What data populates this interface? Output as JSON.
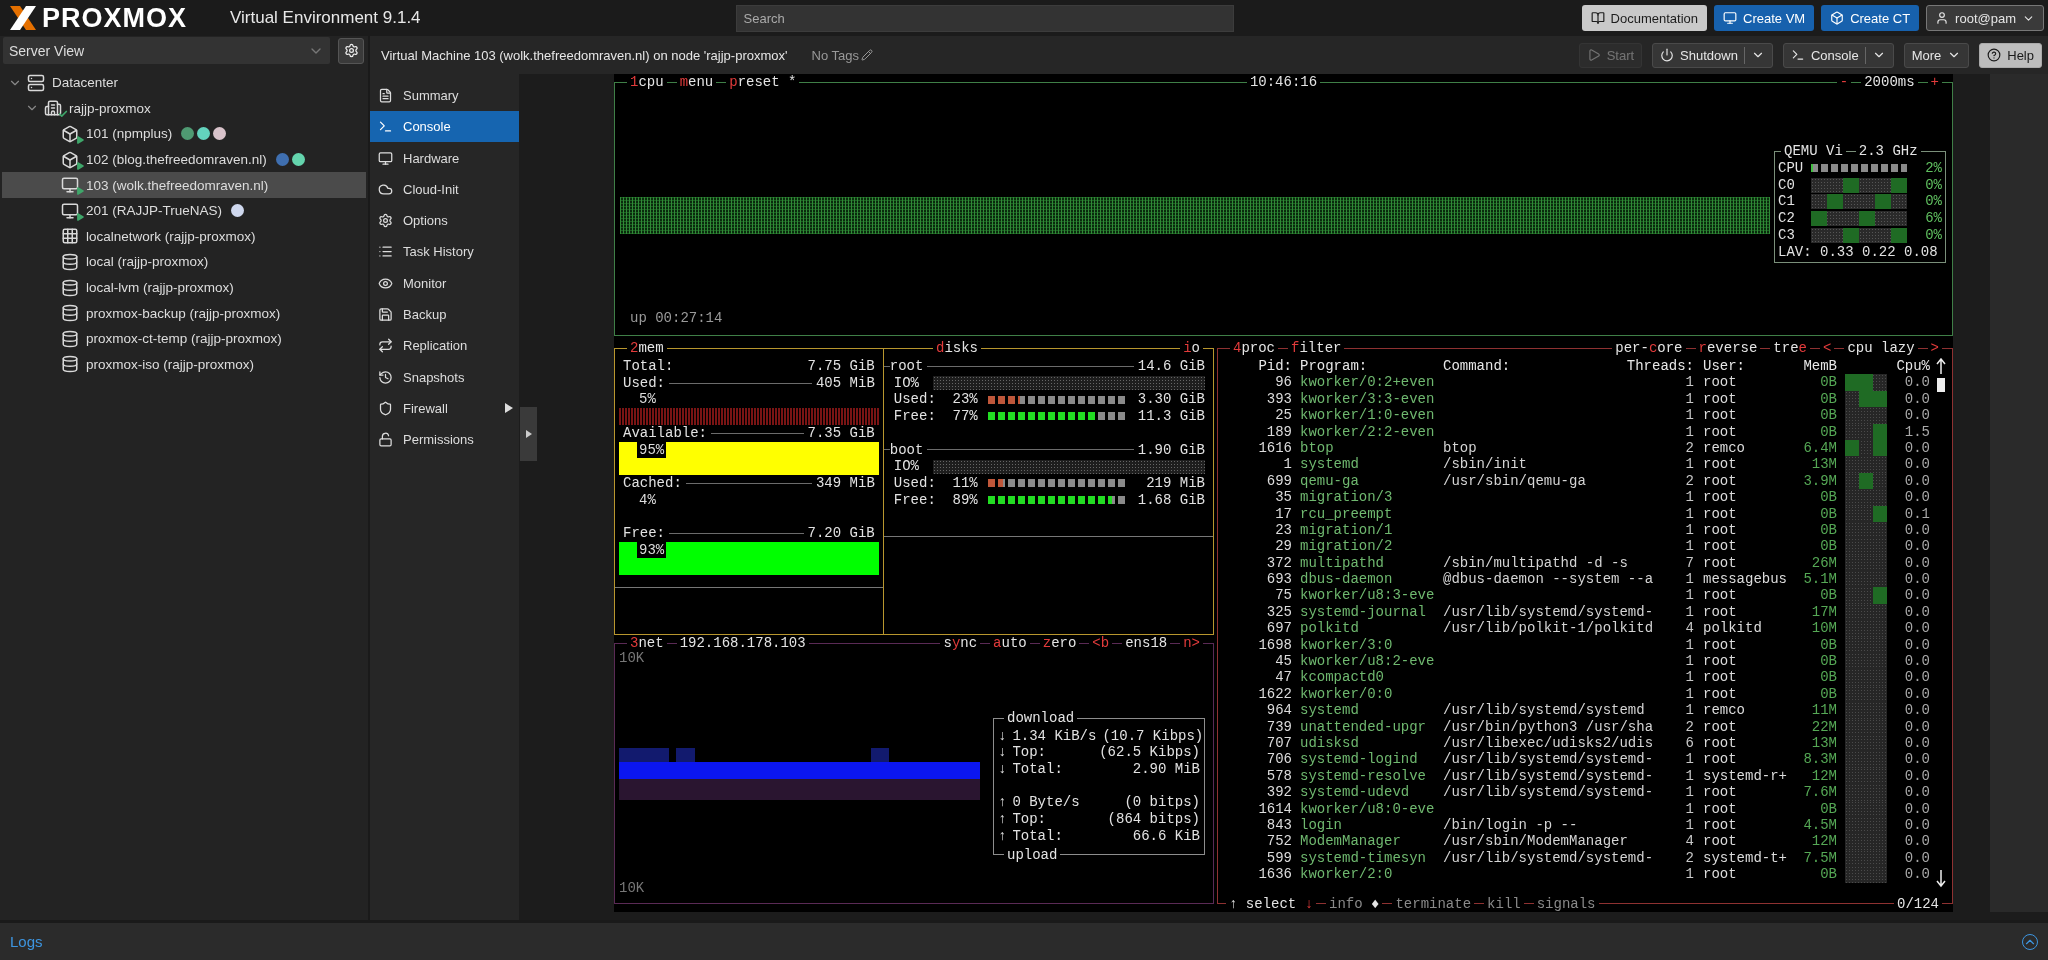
{
  "topbar": {
    "brand": "PROXMOX",
    "product": "Virtual Environment 9.1.4",
    "search": {
      "placeholder": "Search"
    },
    "buttons": [
      {
        "label": "Documentation",
        "kind": "light"
      },
      {
        "label": "Create VM",
        "kind": "primary"
      },
      {
        "label": "Create CT",
        "kind": "primary"
      },
      {
        "label": "root@pam",
        "kind": "menu"
      }
    ]
  },
  "sidebar": {
    "view": "Server View",
    "tree": [
      {
        "label": "Datacenter",
        "kind": "datacenter",
        "expanded": true,
        "selected": false,
        "children": [
          {
            "label": "rajjp-proxmox",
            "kind": "node",
            "online": true,
            "expanded": true,
            "selected": false,
            "children": [
              {
                "label": "101 (npmplus)",
                "kind": "ct",
                "running": true,
                "selected": false,
                "tags": [
                  {
                    "color": "#4f9a72"
                  },
                  {
                    "color": "#63d3bd"
                  },
                  {
                    "color": "#d9c3cb"
                  }
                ]
              },
              {
                "label": "102 (blog.thefreedomraven.nl)",
                "kind": "ct",
                "running": true,
                "selected": false,
                "tags": [
                  {
                    "color": "#3f6fb0"
                  },
                  {
                    "color": "#64d4ad"
                  }
                ]
              },
              {
                "label": "103 (wolk.thefreedomraven.nl)",
                "kind": "vm",
                "running": true,
                "selected": true
              },
              {
                "label": "201 (RAJJP-TrueNAS)",
                "kind": "vm",
                "running": true,
                "selected": false,
                "tags": [
                  {
                    "color": "#cfd8ee"
                  }
                ]
              },
              {
                "label": "localnetwork (rajjp-proxmox)",
                "kind": "sdn",
                "selected": false
              },
              {
                "label": "local (rajjp-proxmox)",
                "kind": "storage",
                "selected": false
              },
              {
                "label": "local-lvm (rajjp-proxmox)",
                "kind": "storage",
                "selected": false
              },
              {
                "label": "proxmox-backup (rajjp-proxmox)",
                "kind": "storage",
                "selected": false
              },
              {
                "label": "proxmox-ct-temp (rajjp-proxmox)",
                "kind": "storage",
                "selected": false
              },
              {
                "label": "proxmox-iso (rajjp-proxmox)",
                "kind": "storage",
                "selected": false
              }
            ]
          }
        ]
      }
    ]
  },
  "content": {
    "title": "Virtual Machine 103 (wolk.thefreedomraven.nl) on node 'rajjp-proxmox'",
    "tags": "No Tags",
    "toolbar": [
      {
        "label": "Start",
        "kind": "plain",
        "disabled": true
      },
      {
        "label": "Shutdown",
        "kind": "split",
        "disabled": false
      },
      {
        "label": "Console",
        "kind": "split",
        "disabled": false
      },
      {
        "label": "More",
        "kind": "menu",
        "disabled": false
      },
      {
        "label": "Help",
        "kind": "light",
        "disabled": false
      }
    ]
  },
  "nav": [
    {
      "label": "Summary",
      "selected": false,
      "submenu": false
    },
    {
      "label": "Console",
      "selected": true,
      "submenu": false
    },
    {
      "label": "Hardware",
      "selected": false,
      "submenu": false
    },
    {
      "label": "Cloud-Init",
      "selected": false,
      "submenu": false
    },
    {
      "label": "Options",
      "selected": false,
      "submenu": false
    },
    {
      "label": "Task History",
      "selected": false,
      "submenu": false
    },
    {
      "label": "Monitor",
      "selected": false,
      "submenu": false
    },
    {
      "label": "Backup",
      "selected": false,
      "submenu": false
    },
    {
      "label": "Replication",
      "selected": false,
      "submenu": false
    },
    {
      "label": "Snapshots",
      "selected": false,
      "submenu": false
    },
    {
      "label": "Firewall",
      "selected": false,
      "submenu": true
    },
    {
      "label": "Permissions",
      "selected": false,
      "submenu": false
    }
  ],
  "terminal": {
    "cpu": {
      "titles": [
        [
          {
            "text": "1",
            "hotkey": true
          },
          {
            "text": "cpu",
            "hotkey": false
          }
        ],
        [
          {
            "text": "m",
            "hotkey": true
          },
          {
            "text": "enu",
            "hotkey": false
          }
        ],
        [
          {
            "text": "p",
            "hotkey": true
          },
          {
            "text": "reset *",
            "hotkey": false
          }
        ]
      ],
      "clock": "10:46:16",
      "right_titles": [
        [
          {
            "text": "-",
            "hotkey": true
          }
        ],
        [
          {
            "text": "2000ms",
            "hotkey": false
          }
        ],
        [
          {
            "text": "+",
            "hotkey": true
          }
        ]
      ],
      "uptime": "up 00:27:14",
      "panel": {
        "name": "QEMU Vi",
        "freq": "2.3 GHz",
        "rows": [
          {
            "label": "CPU",
            "kind": "meter",
            "level": 0.02,
            "value": "2%"
          },
          {
            "label": "C0",
            "kind": "graph",
            "value": "0%"
          },
          {
            "label": "C1",
            "kind": "graph",
            "value": "0%"
          },
          {
            "label": "C2",
            "kind": "graph",
            "value": "6%"
          },
          {
            "label": "C3",
            "kind": "graph",
            "value": "0%"
          }
        ],
        "load": "LAV: 0.33 0.22 0.08"
      }
    },
    "mem": {
      "titles": [
        [
          {
            "text": "2",
            "hotkey": true
          },
          {
            "text": "mem",
            "hotkey": false
          }
        ]
      ],
      "total": {
        "label": "Total:",
        "value": "7.75 GiB"
      },
      "rows": [
        {
          "label": "Used:",
          "value": "405 MiB",
          "percent": "5%",
          "kind": "dim",
          "color": "#7a1414"
        },
        {
          "label": "Available:",
          "value": "7.35 GiB",
          "percent": "95%",
          "kind": "bar",
          "color": "#ffff00"
        },
        {
          "label": "Cached:",
          "value": "349 MiB",
          "percent": "4%",
          "kind": "none"
        },
        {
          "label": "Free:",
          "value": "7.20 GiB",
          "percent": "93%",
          "kind": "bar",
          "color": "#00ff00"
        }
      ]
    },
    "disks": {
      "titles": [
        [
          {
            "text": "d",
            "hotkey": true
          },
          {
            "text": "isks",
            "hotkey": false
          }
        ]
      ],
      "right_titles": [
        [
          {
            "text": "i",
            "hotkey": true
          },
          {
            "text": "o",
            "hotkey": false
          }
        ]
      ],
      "items": [
        {
          "name": "root",
          "size": "14.6 GiB",
          "io": "IO%",
          "used": {
            "label": "Used:",
            "percent": "23%",
            "level": 0.23,
            "value": "3.30 GiB"
          },
          "free": {
            "label": "Free:",
            "percent": "77%",
            "level": 0.77,
            "value": "11.3 GiB"
          }
        },
        {
          "name": "boot",
          "size": "1.90 GiB",
          "io": "IO%",
          "used": {
            "label": "Used:",
            "percent": "11%",
            "level": 0.11,
            "value": "219 MiB"
          },
          "free": {
            "label": "Free:",
            "percent": "89%",
            "level": 0.89,
            "value": "1.68 GiB"
          }
        }
      ]
    },
    "net": {
      "titles": [
        [
          {
            "text": "3",
            "hotkey": true
          },
          {
            "text": "net",
            "hotkey": false
          }
        ],
        [
          {
            "text": "192.168.178.103",
            "hotkey": false
          }
        ]
      ],
      "right_titles": [
        [
          {
            "text": "s",
            "hotkey": false
          },
          {
            "text": "y",
            "hotkey": true
          },
          {
            "text": "nc",
            "hotkey": false
          }
        ],
        [
          {
            "text": "a",
            "hotkey": true
          },
          {
            "text": "uto",
            "hotkey": false
          }
        ],
        [
          {
            "text": "z",
            "hotkey": true
          },
          {
            "text": "ero",
            "hotkey": false
          }
        ],
        [
          {
            "text": "<b",
            "hotkey": true
          }
        ],
        [
          {
            "text": "ens18",
            "hotkey": false
          }
        ],
        [
          {
            "text": "n>",
            "hotkey": true
          }
        ]
      ],
      "scale_top": "10K",
      "scale_bottom": "10K",
      "download": {
        "title": "download",
        "rows": [
          {
            "arrow": "↓",
            "label": "1.34 KiB/s",
            "value": "(10.7 Kibps)"
          },
          {
            "arrow": "↓",
            "label": "Top:",
            "value": "(62.5 Kibps)"
          },
          {
            "arrow": "↓",
            "label": "Total:",
            "value": "2.90 MiB"
          }
        ]
      },
      "upload": {
        "title": "upload",
        "rows": [
          {
            "arrow": "↑",
            "label": "0 Byte/s",
            "value": "(0 bitps)"
          },
          {
            "arrow": "↑",
            "label": "Top:",
            "value": "(864 bitps)"
          },
          {
            "arrow": "↑",
            "label": "Total:",
            "value": "66.6 KiB"
          }
        ]
      }
    },
    "proc": {
      "titles": [
        [
          {
            "text": "4",
            "hotkey": true
          },
          {
            "text": "proc",
            "hotkey": false
          }
        ],
        [
          {
            "text": "f",
            "hotkey": true
          },
          {
            "text": "ilter",
            "hotkey": false
          }
        ]
      ],
      "right_titles": [
        [
          {
            "text": "per-",
            "hotkey": false
          },
          {
            "text": "c",
            "hotkey": true
          },
          {
            "text": "ore",
            "hotkey": false
          }
        ],
        [
          {
            "text": "r",
            "hotkey": true
          },
          {
            "text": "everse",
            "hotkey": false
          }
        ],
        [
          {
            "text": "tre",
            "hotkey": false
          },
          {
            "text": "e",
            "hotkey": true
          }
        ],
        [
          {
            "text": "<",
            "hotkey": true
          }
        ],
        [
          {
            "text": "cpu lazy",
            "hotkey": false
          }
        ],
        [
          {
            "text": ">",
            "hotkey": true
          }
        ]
      ],
      "columns": [
        "Pid:",
        "Program:",
        "Command:",
        "Threads:",
        "User:",
        "MemB",
        "Cpu%"
      ],
      "rows": [
        {
          "pid": "96",
          "program": "kworker/0:2+even",
          "threads": "1",
          "user": "root",
          "mem": "0B",
          "cpu": "0.0"
        },
        {
          "pid": "393",
          "program": "kworker/3:3-even",
          "threads": "1",
          "user": "root",
          "mem": "0B",
          "cpu": "0.0"
        },
        {
          "pid": "25",
          "program": "kworker/1:0-even",
          "threads": "1",
          "user": "root",
          "mem": "0B",
          "cpu": "0.0"
        },
        {
          "pid": "189",
          "program": "kworker/2:2-even",
          "threads": "1",
          "user": "root",
          "mem": "0B",
          "cpu": "1.5"
        },
        {
          "pid": "1616",
          "program": "btop",
          "command": "btop",
          "threads": "2",
          "user": "remco",
          "mem": "6.4M",
          "cpu": "0.0"
        },
        {
          "pid": "1",
          "program": "systemd",
          "command": "/sbin/init",
          "threads": "1",
          "user": "root",
          "mem": "13M",
          "cpu": "0.0"
        },
        {
          "pid": "699",
          "program": "qemu-ga",
          "command": "/usr/sbin/qemu-ga",
          "threads": "2",
          "user": "root",
          "mem": "3.9M",
          "cpu": "0.0"
        },
        {
          "pid": "35",
          "program": "migration/3",
          "threads": "1",
          "user": "root",
          "mem": "0B",
          "cpu": "0.0"
        },
        {
          "pid": "17",
          "program": "rcu_preempt",
          "threads": "1",
          "user": "root",
          "mem": "0B",
          "cpu": "0.1"
        },
        {
          "pid": "23",
          "program": "migration/1",
          "threads": "1",
          "user": "root",
          "mem": "0B",
          "cpu": "0.0"
        },
        {
          "pid": "29",
          "program": "migration/2",
          "threads": "1",
          "user": "root",
          "mem": "0B",
          "cpu": "0.0"
        },
        {
          "pid": "372",
          "program": "multipathd",
          "command": "/sbin/multipathd -d -s",
          "threads": "7",
          "user": "root",
          "mem": "26M",
          "cpu": "0.0"
        },
        {
          "pid": "693",
          "program": "dbus-daemon",
          "command": "@dbus-daemon --system --a",
          "threads": "1",
          "user": "messagebus",
          "mem": "5.1M",
          "cpu": "0.0"
        },
        {
          "pid": "75",
          "program": "kworker/u8:3-eve",
          "threads": "1",
          "user": "root",
          "mem": "0B",
          "cpu": "0.0"
        },
        {
          "pid": "325",
          "program": "systemd-journal",
          "command": "/usr/lib/systemd/systemd-",
          "threads": "1",
          "user": "root",
          "mem": "17M",
          "cpu": "0.0"
        },
        {
          "pid": "697",
          "program": "polkitd",
          "command": "/usr/lib/polkit-1/polkitd",
          "threads": "4",
          "user": "polkitd",
          "mem": "10M",
          "cpu": "0.0"
        },
        {
          "pid": "1698",
          "program": "kworker/3:0",
          "threads": "1",
          "user": "root",
          "mem": "0B",
          "cpu": "0.0"
        },
        {
          "pid": "45",
          "program": "kworker/u8:2-eve",
          "threads": "1",
          "user": "root",
          "mem": "0B",
          "cpu": "0.0"
        },
        {
          "pid": "47",
          "program": "kcompactd0",
          "threads": "1",
          "user": "root",
          "mem": "0B",
          "cpu": "0.0"
        },
        {
          "pid": "1622",
          "program": "kworker/0:0",
          "threads": "1",
          "user": "root",
          "mem": "0B",
          "cpu": "0.0"
        },
        {
          "pid": "964",
          "program": "systemd",
          "command": "/usr/lib/systemd/systemd",
          "threads": "1",
          "user": "remco",
          "mem": "11M",
          "cpu": "0.0"
        },
        {
          "pid": "739",
          "program": "unattended-upgr",
          "command": "/usr/bin/python3 /usr/sha",
          "threads": "2",
          "user": "root",
          "mem": "22M",
          "cpu": "0.0"
        },
        {
          "pid": "707",
          "program": "udisksd",
          "command": "/usr/libexec/udisks2/udis",
          "threads": "6",
          "user": "root",
          "mem": "13M",
          "cpu": "0.0"
        },
        {
          "pid": "706",
          "program": "systemd-logind",
          "command": "/usr/lib/systemd/systemd-",
          "threads": "1",
          "user": "root",
          "mem": "8.3M",
          "cpu": "0.0"
        },
        {
          "pid": "578",
          "program": "systemd-resolve",
          "command": "/usr/lib/systemd/systemd-",
          "threads": "1",
          "user": "systemd-r+",
          "mem": "12M",
          "cpu": "0.0"
        },
        {
          "pid": "392",
          "program": "systemd-udevd",
          "command": "/usr/lib/systemd/systemd-",
          "threads": "1",
          "user": "root",
          "mem": "7.6M",
          "cpu": "0.0"
        },
        {
          "pid": "1614",
          "program": "kworker/u8:0-eve",
          "threads": "1",
          "user": "root",
          "mem": "0B",
          "cpu": "0.0"
        },
        {
          "pid": "843",
          "program": "login",
          "command": "/bin/login -p --",
          "threads": "1",
          "user": "root",
          "mem": "4.5M",
          "cpu": "0.0"
        },
        {
          "pid": "752",
          "program": "ModemManager",
          "command": "/usr/sbin/ModemManager",
          "threads": "4",
          "user": "root",
          "mem": "12M",
          "cpu": "0.0"
        },
        {
          "pid": "599",
          "program": "systemd-timesyn",
          "command": "/usr/lib/systemd/systemd-",
          "threads": "2",
          "user": "systemd-t+",
          "mem": "7.5M",
          "cpu": "0.0"
        },
        {
          "pid": "1636",
          "program": "kworker/2:0",
          "threads": "1",
          "user": "root",
          "mem": "0B",
          "cpu": "0.0"
        }
      ],
      "footer": [
        [
          {
            "text": "↑ select ",
            "hotkey": false,
            "dimmed": false
          },
          {
            "text": "↓",
            "hotkey": true,
            "dimmed": false
          }
        ],
        [
          {
            "text": "info ",
            "hotkey": false,
            "dimmed": true
          },
          {
            "text": "♦",
            "hotkey": false,
            "dimmed": false
          }
        ],
        [
          {
            "text": "terminate",
            "hotkey": false,
            "dimmed": true
          }
        ],
        [
          {
            "text": "kill",
            "hotkey": false,
            "dimmed": true
          }
        ],
        [
          {
            "text": "signals",
            "hotkey": false,
            "dimmed": true
          }
        ]
      ],
      "counter": "0/124"
    }
  },
  "logs": {
    "title": "Logs"
  }
}
